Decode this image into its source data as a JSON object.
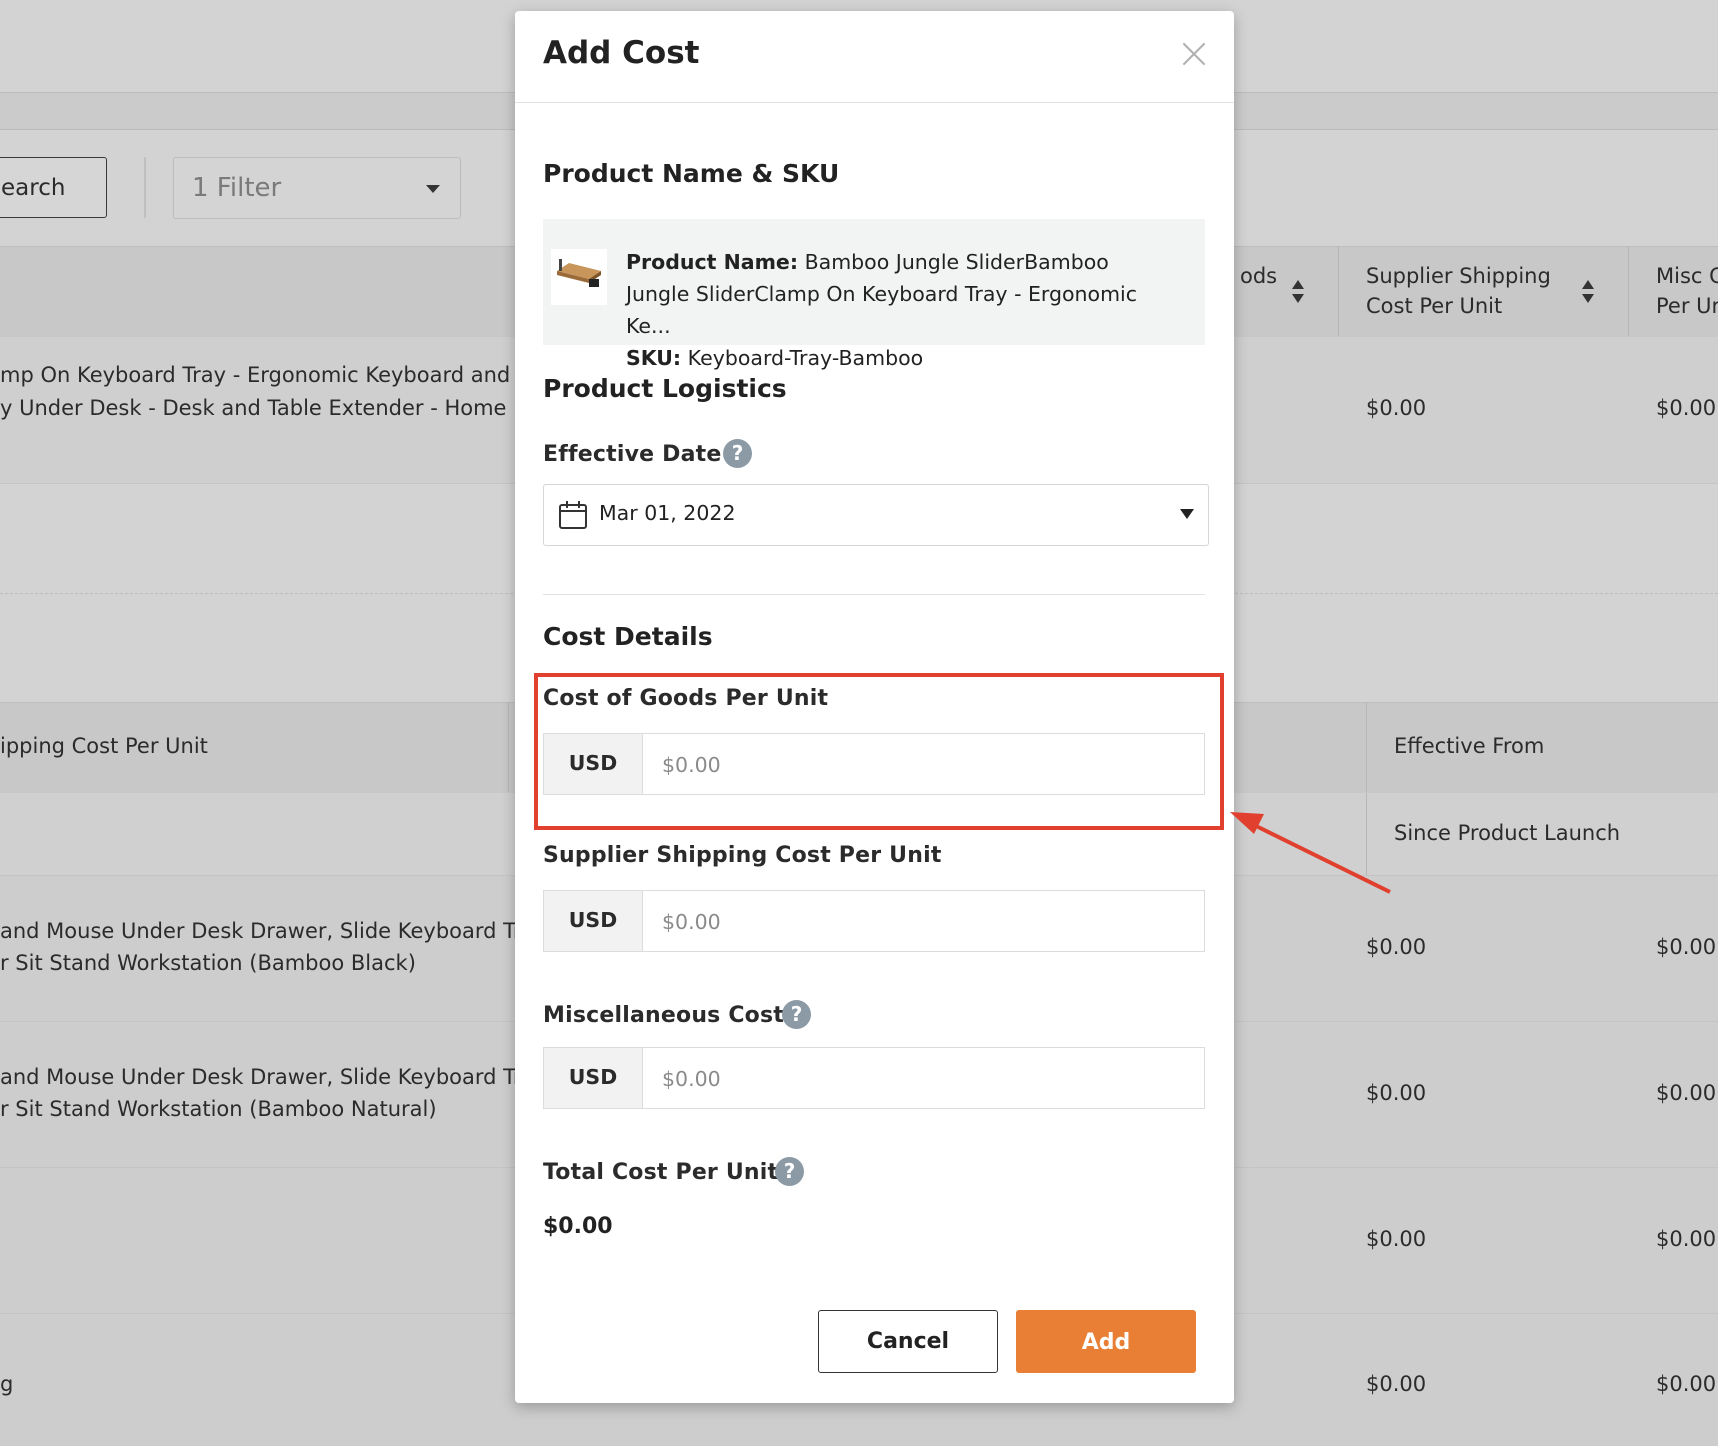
{
  "background": {
    "search_label": "earch",
    "filter_label": "1 Filter",
    "table1": {
      "col_goods_partial": "ods",
      "col_supplier_shipping": [
        "Supplier Shipping",
        "Cost Per Unit"
      ],
      "col_misc_partial": [
        "Misc C",
        "Per Ur"
      ],
      "row1_text": [
        "mp On Keyboard Tray - Ergonomic Keyboard and",
        "y Under Desk - Desk and Table Extender - Home"
      ],
      "row1_values": [
        "$0.00",
        "$0.00"
      ]
    },
    "table2": {
      "col_shipping_partial": "ipping Cost Per Unit",
      "col_effective_from": "Effective From",
      "sub_value": "Since Product Launch",
      "rows": [
        {
          "text": [
            "and Mouse Under Desk Drawer, Slide Keyboard Tr",
            "r Sit Stand Workstation (Bamboo Black)"
          ],
          "values": [
            "$0.00",
            "$0.00"
          ]
        },
        {
          "text": [
            "and Mouse Under Desk Drawer, Slide Keyboard Tr",
            "r Sit Stand Workstation (Bamboo Natural)"
          ],
          "values": [
            "$0.00",
            "$0.00"
          ]
        },
        {
          "text": [
            "",
            ""
          ],
          "values": [
            "$0.00",
            "$0.00"
          ]
        },
        {
          "text": [
            "g",
            ""
          ],
          "values": [
            "$0.00",
            "$0.00"
          ]
        }
      ]
    }
  },
  "modal": {
    "title": "Add Cost",
    "product_section_title": "Product Name & SKU",
    "product_name_label": "Product Name:",
    "product_name_value": "Bamboo Jungle SliderBamboo Jungle SliderClamp On Keyboard Tray - Ergonomic Ke...",
    "product_name_lines": [
      "Bamboo Jungle SliderBamboo",
      "Jungle SliderClamp On Keyboard Tray - Ergonomic",
      "Ke..."
    ],
    "sku_label": "SKU:",
    "sku_value": "Keyboard-Tray-Bamboo",
    "logistics_title": "Product Logistics",
    "effective_date_label": "Effective Date",
    "effective_date_value": "Mar 01, 2022",
    "cost_details_title": "Cost Details",
    "cogs_label": "Cost of Goods Per Unit",
    "supplier_shipping_label": "Supplier Shipping Cost Per Unit",
    "misc_label": "Miscellaneous Cost",
    "currency": "USD",
    "amount_placeholder": "$0.00",
    "total_label": "Total Cost Per Unit",
    "total_value": "$0.00",
    "cancel_label": "Cancel",
    "add_label": "Add",
    "help_glyph": "?"
  },
  "colors": {
    "accent": "#e87f34",
    "annotation": "#e0402d"
  }
}
